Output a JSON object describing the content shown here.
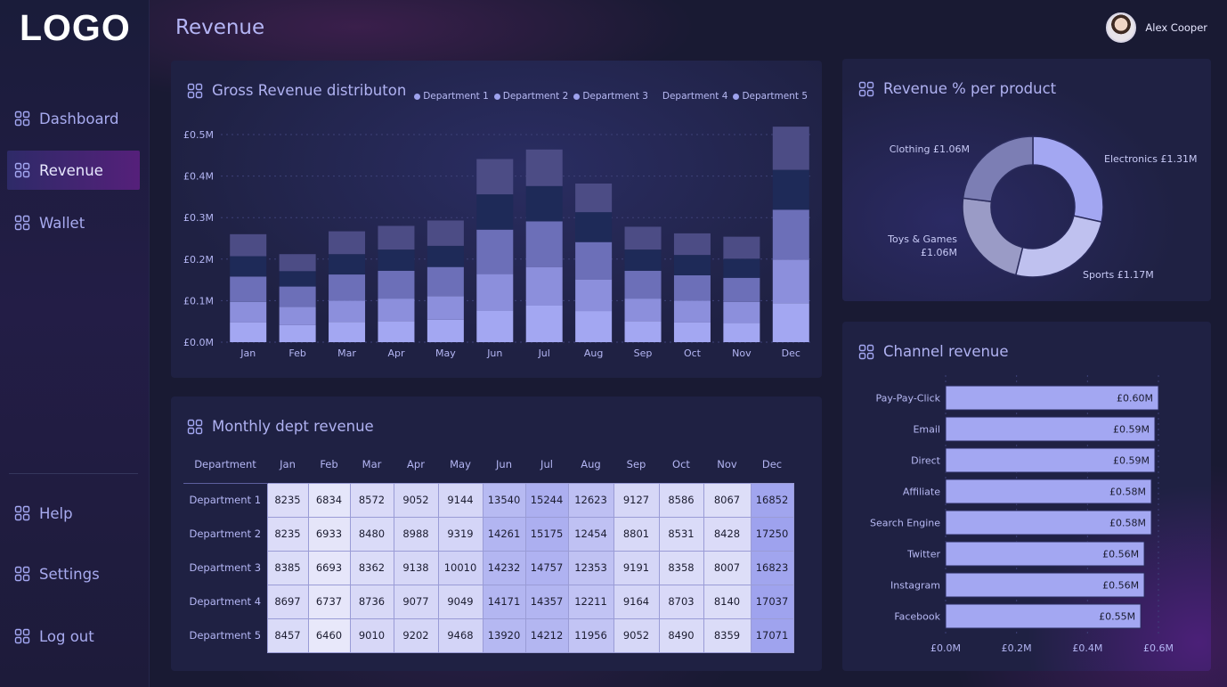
{
  "app": {
    "logo": "LOGO",
    "page_title": "Revenue",
    "user_name": "Alex Cooper"
  },
  "sidebar": {
    "items": [
      {
        "label": "Dashboard",
        "icon": "grid-icon",
        "active": false
      },
      {
        "label": "Revenue",
        "icon": "grid-icon",
        "active": true
      },
      {
        "label": "Wallet",
        "icon": "grid-icon",
        "active": false
      }
    ],
    "bottom_items": [
      {
        "label": "Help",
        "icon": "grid-icon"
      },
      {
        "label": "Settings",
        "icon": "grid-icon"
      },
      {
        "label": "Log out",
        "icon": "grid-icon"
      }
    ]
  },
  "colors": {
    "background": "#191a33",
    "panel": "#1f2143",
    "accent": "#9ea2ee",
    "active_nav": "#55207a",
    "text": "#b0b2f2"
  },
  "panels": {
    "gross": {
      "title": "Gross Revenue distributon"
    },
    "share": {
      "title": "Revenue % per product"
    },
    "monthly": {
      "title": "Monthly dept revenue"
    },
    "channel": {
      "title": "Channel revenue"
    }
  },
  "chart_data": [
    {
      "type": "bar",
      "stacked": true,
      "title": "Gross Revenue distributon",
      "categories": [
        "Jan",
        "Feb",
        "Mar",
        "Apr",
        "May",
        "Jun",
        "Jul",
        "Aug",
        "Sep",
        "Oct",
        "Nov",
        "Dec"
      ],
      "legend": [
        "Department 1",
        "Department 2",
        "Department 3",
        "Department 4",
        "Department 5"
      ],
      "series": [
        {
          "name": "Department 1",
          "color": "#a3a7f2",
          "values": [
            0.048,
            0.041,
            0.049,
            0.051,
            0.054,
            0.076,
            0.088,
            0.075,
            0.051,
            0.048,
            0.046,
            0.094
          ]
        },
        {
          "name": "Department 2",
          "color": "#8c8fdc",
          "values": [
            0.049,
            0.044,
            0.051,
            0.054,
            0.057,
            0.088,
            0.093,
            0.076,
            0.054,
            0.052,
            0.051,
            0.105
          ]
        },
        {
          "name": "Department 3",
          "color": "#6c6fb8",
          "values": [
            0.061,
            0.049,
            0.063,
            0.067,
            0.07,
            0.107,
            0.11,
            0.09,
            0.067,
            0.061,
            0.058,
            0.12
          ]
        },
        {
          "name": "Department 4",
          "color": "#1e2a58",
          "values": [
            0.049,
            0.037,
            0.049,
            0.051,
            0.051,
            0.085,
            0.085,
            0.072,
            0.051,
            0.049,
            0.046,
            0.096
          ]
        },
        {
          "name": "Department 5",
          "color": "#4c4c85",
          "values": [
            0.053,
            0.041,
            0.055,
            0.057,
            0.061,
            0.085,
            0.088,
            0.069,
            0.055,
            0.052,
            0.053,
            0.104
          ]
        }
      ],
      "yticks": [
        "£0.0M",
        "£0.1M",
        "£0.2M",
        "£0.3M",
        "£0.4M",
        "£0.5M"
      ],
      "ylim": [
        0,
        0.5
      ],
      "grid": true,
      "legend_position": "top-right"
    },
    {
      "type": "pie",
      "donut": true,
      "title": "Revenue % per product",
      "slices": [
        {
          "label": "Electronics £1.31M",
          "value": 1.31,
          "color": "#a3a7f2"
        },
        {
          "label": "Sports £1.17M",
          "value": 1.17,
          "color": "#bfc1ef"
        },
        {
          "label": "Toys & Games\n£1.06M",
          "value": 1.06,
          "color": "#9a9bc6"
        },
        {
          "label": "Clothing £1.06M",
          "value": 1.06,
          "color": "#7c7eb4"
        }
      ]
    },
    {
      "type": "table",
      "title": "Monthly dept revenue",
      "header_label": "Department",
      "columns": [
        "Jan",
        "Feb",
        "Mar",
        "Apr",
        "May",
        "Jun",
        "Jul",
        "Aug",
        "Sep",
        "Oct",
        "Nov",
        "Dec"
      ],
      "rows": [
        {
          "name": "Department 1",
          "values": [
            8235,
            6834,
            8572,
            9052,
            9144,
            13540,
            15244,
            12623,
            9127,
            8586,
            8067,
            16852
          ]
        },
        {
          "name": "Department 2",
          "values": [
            8235,
            6933,
            8480,
            8988,
            9319,
            14261,
            15175,
            12454,
            8801,
            8531,
            8428,
            17250
          ]
        },
        {
          "name": "Department 3",
          "values": [
            8385,
            6693,
            8362,
            9138,
            10010,
            14232,
            14757,
            12353,
            9191,
            8358,
            8007,
            16823
          ]
        },
        {
          "name": "Department 4",
          "values": [
            8697,
            6737,
            8736,
            9077,
            9049,
            14171,
            14357,
            12211,
            9164,
            8703,
            8140,
            17037
          ]
        },
        {
          "name": "Department 5",
          "values": [
            8457,
            6460,
            9010,
            9202,
            9468,
            13920,
            14212,
            11956,
            9052,
            8490,
            8359,
            17071
          ]
        }
      ]
    },
    {
      "type": "bar",
      "orientation": "horizontal",
      "title": "Channel revenue",
      "categories": [
        "Pay-Pay-Click",
        "Email",
        "Direct",
        "Affiliate",
        "Search Engine",
        "Twitter",
        "Instagram",
        "Facebook"
      ],
      "values": [
        0.6,
        0.59,
        0.59,
        0.58,
        0.58,
        0.56,
        0.56,
        0.55
      ],
      "value_labels": [
        "£0.60M",
        "£0.59M",
        "£0.59M",
        "£0.58M",
        "£0.58M",
        "£0.56M",
        "£0.56M",
        "£0.55M"
      ],
      "xticks": [
        "£0.0M",
        "£0.2M",
        "£0.4M",
        "£0.6M"
      ],
      "xlim": [
        0,
        0.6
      ],
      "color": "#a3a7f2"
    }
  ]
}
